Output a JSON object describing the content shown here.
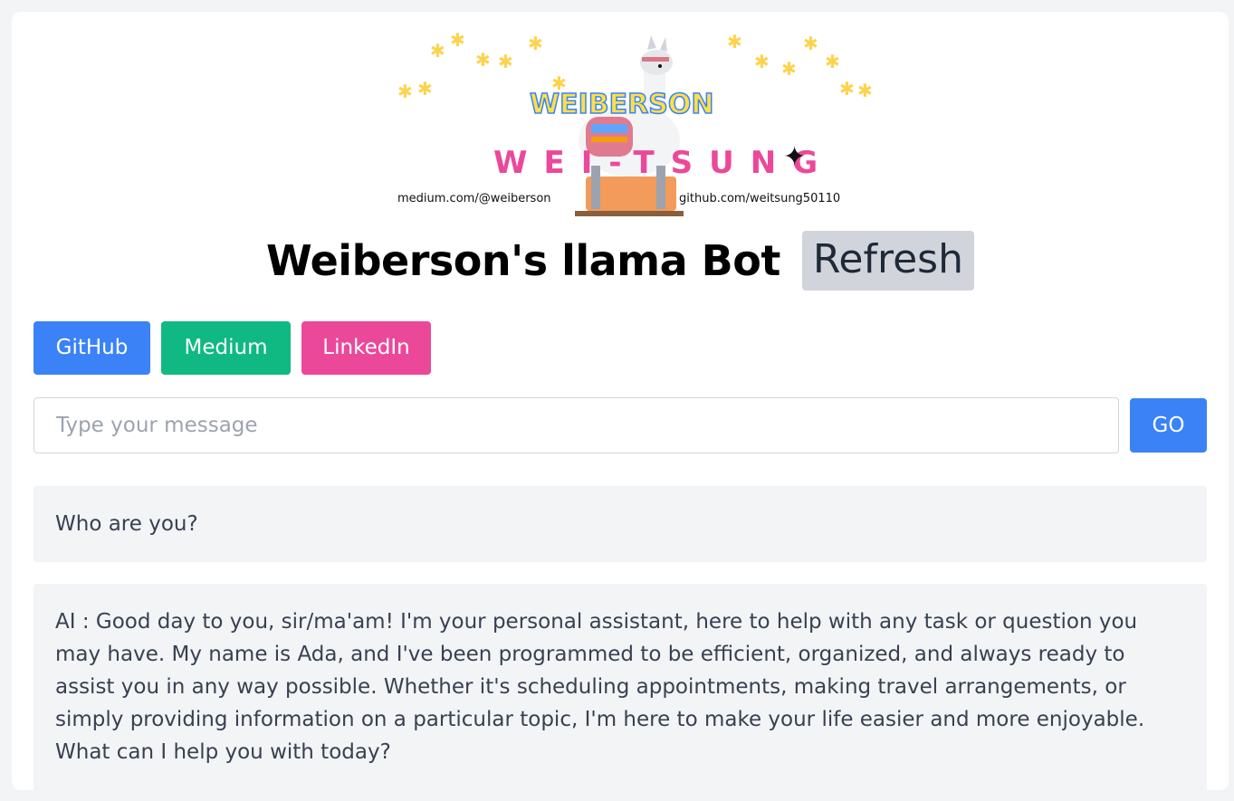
{
  "banner": {
    "line1": "WEIBERSON",
    "line2": "WEI-TSUNG",
    "medium_url": "medium.com/@weiberson",
    "github_url": "github.com/weitsung50110"
  },
  "header": {
    "title": "Weiberson's llama Bot",
    "refresh_label": "Refresh"
  },
  "links": [
    {
      "label": "GitHub",
      "color": "#3b82f6"
    },
    {
      "label": "Medium",
      "color": "#10b981"
    },
    {
      "label": "LinkedIn",
      "color": "#ec4899"
    }
  ],
  "input": {
    "placeholder": "Type your message",
    "value": "",
    "go_label": "GO"
  },
  "chat": {
    "messages": [
      {
        "role": "user",
        "text": "Who are you?"
      },
      {
        "role": "ai",
        "text": "AI : Good day to you, sir/ma'am! I'm your personal assistant, here to help with any task or question you may have. My name is Ada, and I've been programmed to be efficient, organized, and always ready to assist you in any way possible. Whether it's scheduling appointments, making travel arrangements, or simply providing information on a particular topic, I'm here to make your life easier and more enjoyable. What can I help you with today?"
      }
    ]
  }
}
